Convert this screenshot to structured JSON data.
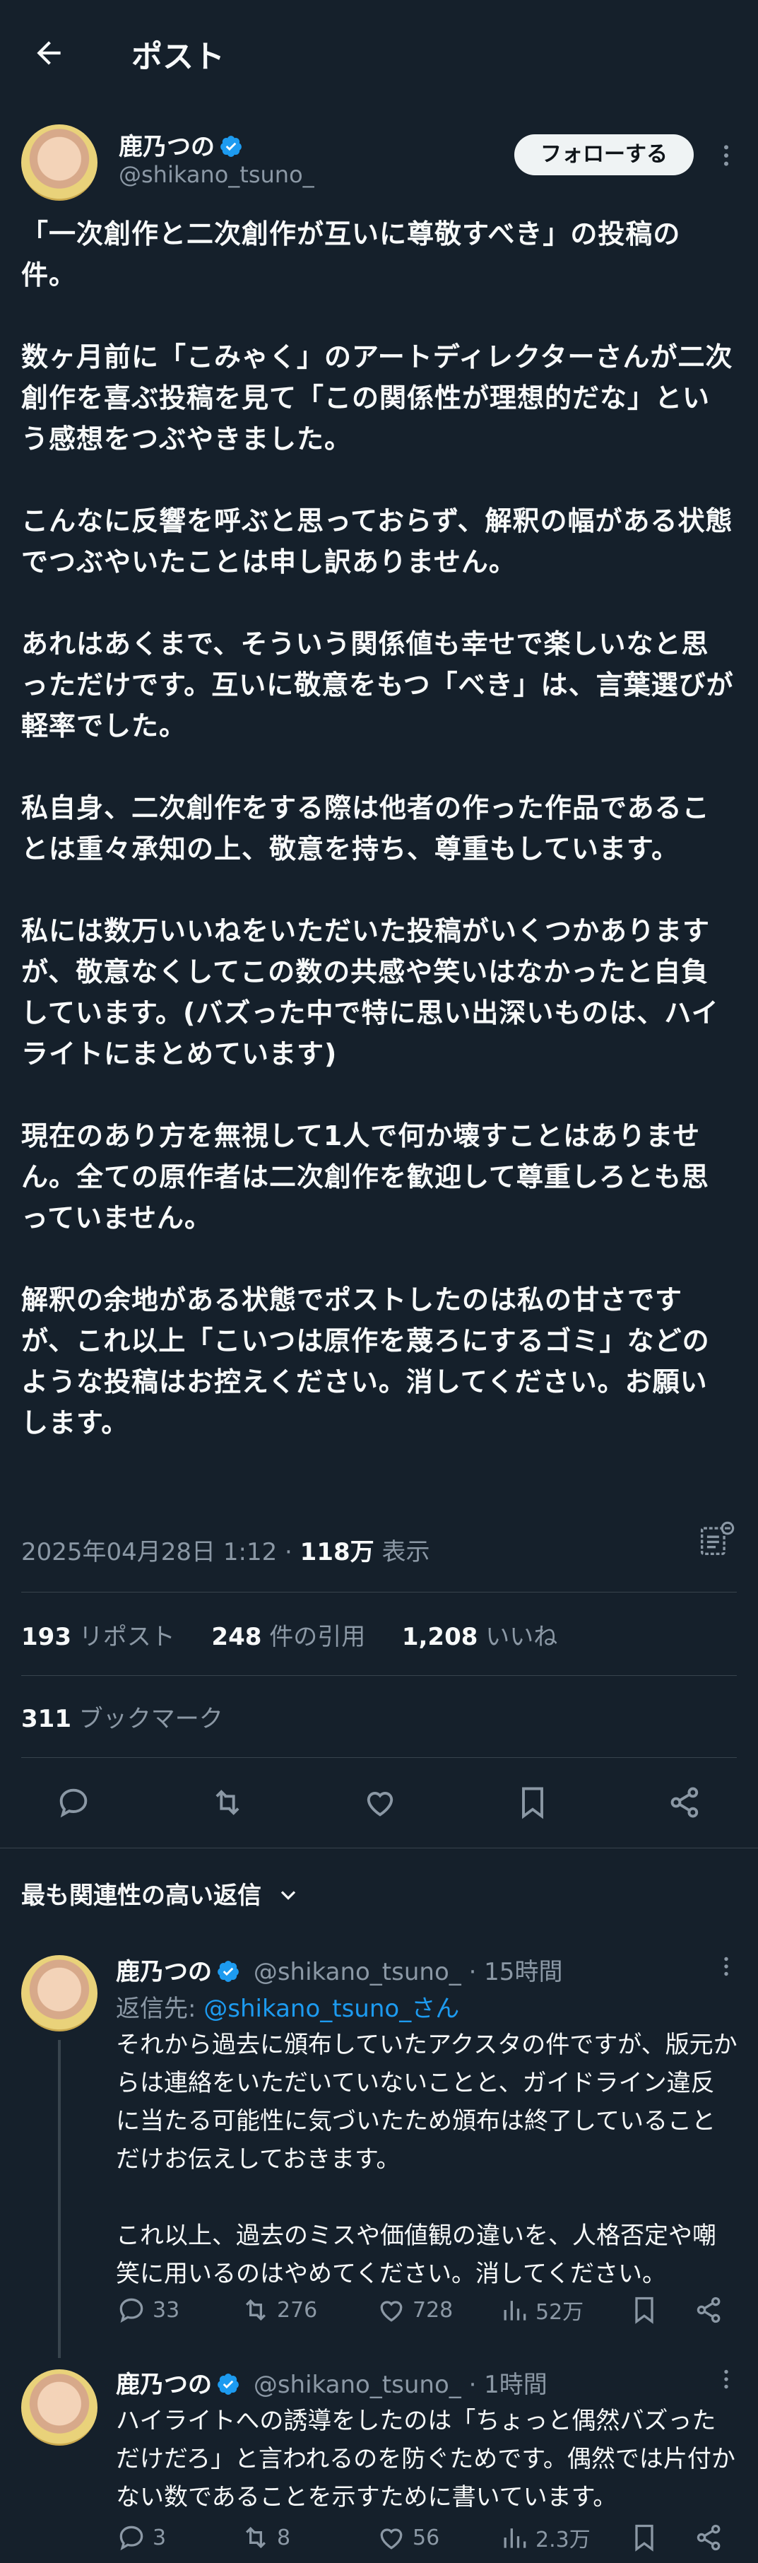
{
  "header": {
    "title": "ポスト"
  },
  "post": {
    "author_name": "鹿乃つの",
    "author_handle": "@shikano_tsuno_",
    "follow_label": "フォローする",
    "body": "「一次創作と二次創作が互いに尊敬すべき」の投稿の件。\n\n数ヶ月前に「こみゃく」のアートディレクターさんが二次創作を喜ぶ投稿を見て「この関係性が理想的だな」という感想をつぶやきました。\n\nこんなに反響を呼ぶと思っておらず、解釈の幅がある状態でつぶやいたことは申し訳ありません。\n\nあれはあくまで、そういう関係値も幸せで楽しいなと思っただけです。互いに敬意をもつ「べき」は、言葉選びが軽率でした。\n\n私自身、二次創作をする際は他者の作った作品であることは重々承知の上、敬意を持ち、尊重もしています。\n\n私には数万いいねをいただいた投稿がいくつかありますが、敬意なくしてこの数の共感や笑いはなかったと自負しています。(バズった中で特に思い出深いものは、ハイライトにまとめています)\n\n現在のあり方を無視して1人で何か壊すことはありません。全ての原作者は二次創作を歓迎して尊重しろとも思っていません。\n\n解釈の余地がある状態でポストしたのは私の甘さですが、これ以上「こいつは原作を蔑ろにするゴミ」などのような投稿はお控えください。消してください。お願いします。",
    "timestamp": "2025年04月28日 1:12",
    "views_num": "118万",
    "views_label": "表示",
    "reposts_num": "193",
    "reposts_label": "リポスト",
    "quotes_num": "248",
    "quotes_label": "件の引用",
    "likes_num": "1,208",
    "likes_label": "いいね",
    "bookmarks_num": "311",
    "bookmarks_label": "ブックマーク"
  },
  "replies_sort_label": "最も関連性の高い返信",
  "replies": [
    {
      "author_name": "鹿乃つの",
      "author_handle": "@shikano_tsuno_",
      "time": "· 15時間",
      "reply_to_prefix": "返信先: ",
      "reply_to_handle": "@shikano_tsuno_さん",
      "text": "それから過去に頒布していたアクスタの件ですが、版元からは連絡をいただいていないことと、ガイドライン違反に当たる可能性に気づいたため頒布は終了していることだけお伝えしておきます。\n\nこれ以上、過去のミスや価値観の違いを、人格否定や嘲笑に用いるのはやめてください。消してください。",
      "replies": "33",
      "reposts": "276",
      "likes": "728",
      "views": "52万"
    },
    {
      "author_name": "鹿乃つの",
      "author_handle": "@shikano_tsuno_",
      "time": "· 1時間",
      "text": "ハイライトへの誘導をしたのは「ちょっと偶然バズっただけだろ」と言われるのを防ぐためです。偶然では片付かない数であることを示すために書いています。",
      "replies": "3",
      "reposts": "8",
      "likes": "56",
      "views": "2.3万"
    }
  ],
  "colors": {
    "background": "#15202b",
    "accent": "#1d9bf0",
    "muted": "#8b98a5",
    "divider": "#38444d"
  }
}
